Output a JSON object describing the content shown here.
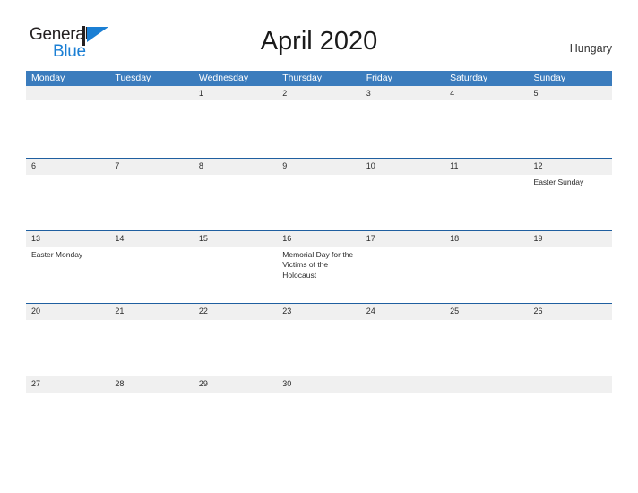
{
  "brand": {
    "name_part1": "General",
    "name_part2": "Blue",
    "flag_icon": "flag-triangle-icon",
    "pole_color": "#231f20",
    "flag_color": "#1b7fd4",
    "text_color_primary": "#231f20",
    "text_color_secondary": "#1b7fd4"
  },
  "header": {
    "title": "April 2020",
    "country": "Hungary"
  },
  "colors": {
    "weekday_header_bg": "#3b7cbd",
    "weekday_header_text": "#ffffff",
    "daynum_bar_bg": "#f0f0f0",
    "week_separator_line": "#1f5fa0",
    "cell_text": "#2b2b2b",
    "page_bg": "#ffffff"
  },
  "calendar": {
    "weekdays": [
      "Monday",
      "Tuesday",
      "Wednesday",
      "Thursday",
      "Friday",
      "Saturday",
      "Sunday"
    ],
    "weeks": [
      {
        "has_top_line": false,
        "days": [
          {
            "num": "",
            "event": ""
          },
          {
            "num": "",
            "event": ""
          },
          {
            "num": "1",
            "event": ""
          },
          {
            "num": "2",
            "event": ""
          },
          {
            "num": "3",
            "event": ""
          },
          {
            "num": "4",
            "event": ""
          },
          {
            "num": "5",
            "event": ""
          }
        ]
      },
      {
        "has_top_line": true,
        "days": [
          {
            "num": "6",
            "event": ""
          },
          {
            "num": "7",
            "event": ""
          },
          {
            "num": "8",
            "event": ""
          },
          {
            "num": "9",
            "event": ""
          },
          {
            "num": "10",
            "event": ""
          },
          {
            "num": "11",
            "event": ""
          },
          {
            "num": "12",
            "event": "Easter Sunday"
          }
        ]
      },
      {
        "has_top_line": true,
        "days": [
          {
            "num": "13",
            "event": "Easter Monday"
          },
          {
            "num": "14",
            "event": ""
          },
          {
            "num": "15",
            "event": ""
          },
          {
            "num": "16",
            "event": "Memorial Day for the Victims of the Holocaust"
          },
          {
            "num": "17",
            "event": ""
          },
          {
            "num": "18",
            "event": ""
          },
          {
            "num": "19",
            "event": ""
          }
        ]
      },
      {
        "has_top_line": true,
        "days": [
          {
            "num": "20",
            "event": ""
          },
          {
            "num": "21",
            "event": ""
          },
          {
            "num": "22",
            "event": ""
          },
          {
            "num": "23",
            "event": ""
          },
          {
            "num": "24",
            "event": ""
          },
          {
            "num": "25",
            "event": ""
          },
          {
            "num": "26",
            "event": ""
          }
        ]
      },
      {
        "has_top_line": true,
        "days": [
          {
            "num": "27",
            "event": ""
          },
          {
            "num": "28",
            "event": ""
          },
          {
            "num": "29",
            "event": ""
          },
          {
            "num": "30",
            "event": ""
          },
          {
            "num": "",
            "event": ""
          },
          {
            "num": "",
            "event": ""
          },
          {
            "num": "",
            "event": ""
          }
        ]
      }
    ]
  }
}
